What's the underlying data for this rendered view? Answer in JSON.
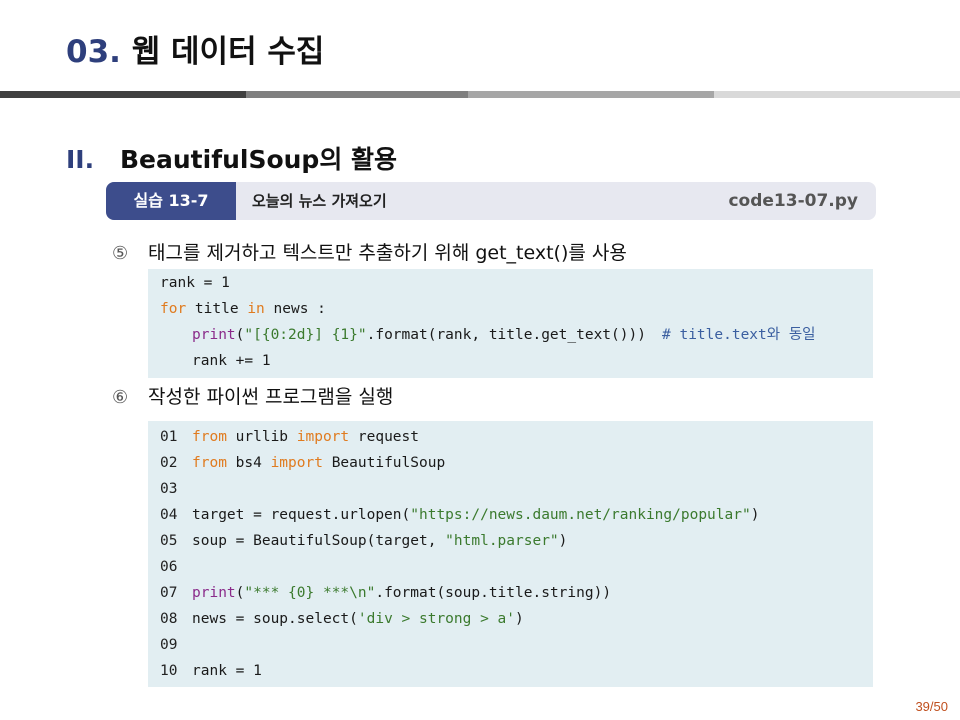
{
  "slide": {
    "title_number": "03.",
    "title_text": " 웹 데이터 수집",
    "section_roman": "II.",
    "section_title": "BeautifulSoup의 활용",
    "page": "39/50"
  },
  "exercise": {
    "tag": "실습 13-7",
    "title": "오늘의 뉴스 가져오기",
    "file": "code13-07.py"
  },
  "steps": [
    {
      "mark": "⑤",
      "text": "태그를 제거하고 텍스트만 추출하기 위해 get_text()를 사용"
    },
    {
      "mark": "⑥",
      "text": "작성한 파이썬 프로그램을 실행"
    }
  ],
  "code1": {
    "l1": "rank = 1",
    "l2_kw1": "for",
    "l2_a": " title ",
    "l2_kw2": "in",
    "l2_b": " news :",
    "l3_fn": "print",
    "l3_a": "(",
    "l3_str": "\"[{0:2d}] {1}\"",
    "l3_b": ".format(rank, title.get_text()))",
    "l3_cmt": "# title.text와 동일",
    "l4": "rank += 1"
  },
  "code2": {
    "n01": "01",
    "n02": "02",
    "n03": "03",
    "n04": "04",
    "n05": "05",
    "n06": "06",
    "n07": "07",
    "n08": "08",
    "n09": "09",
    "n10": "10",
    "from": "from",
    "import": "import",
    "l1_mod": " urllib ",
    "l1_name": " request",
    "l2_mod": " bs4 ",
    "l2_name": " BeautifulSoup",
    "l4_a": "target = request.urlopen(",
    "l4_str": "\"https://news.daum.net/ranking/popular\"",
    "l4_b": ")",
    "l5_a": "soup = BeautifulSoup(target, ",
    "l5_str": "\"html.parser\"",
    "l5_b": ")",
    "l7_fn": "print",
    "l7_a": "(",
    "l7_str": "\"*** {0} ***\\n\"",
    "l7_b": ".format(soup.title.string))",
    "l8_a": "news = soup.select(",
    "l8_str": "'div > strong > a'",
    "l8_b": ")",
    "l10": "rank = 1"
  },
  "colors": {
    "title_number": "#2e3f7c",
    "exercise_tag_bg": "#3d4d8c",
    "code_bg": "#e2eef2",
    "keyword": "#e07b1f",
    "function": "#8a2b8a",
    "string": "#3b7a2e",
    "comment": "#3b5fa0",
    "page_number": "#c0501f"
  }
}
